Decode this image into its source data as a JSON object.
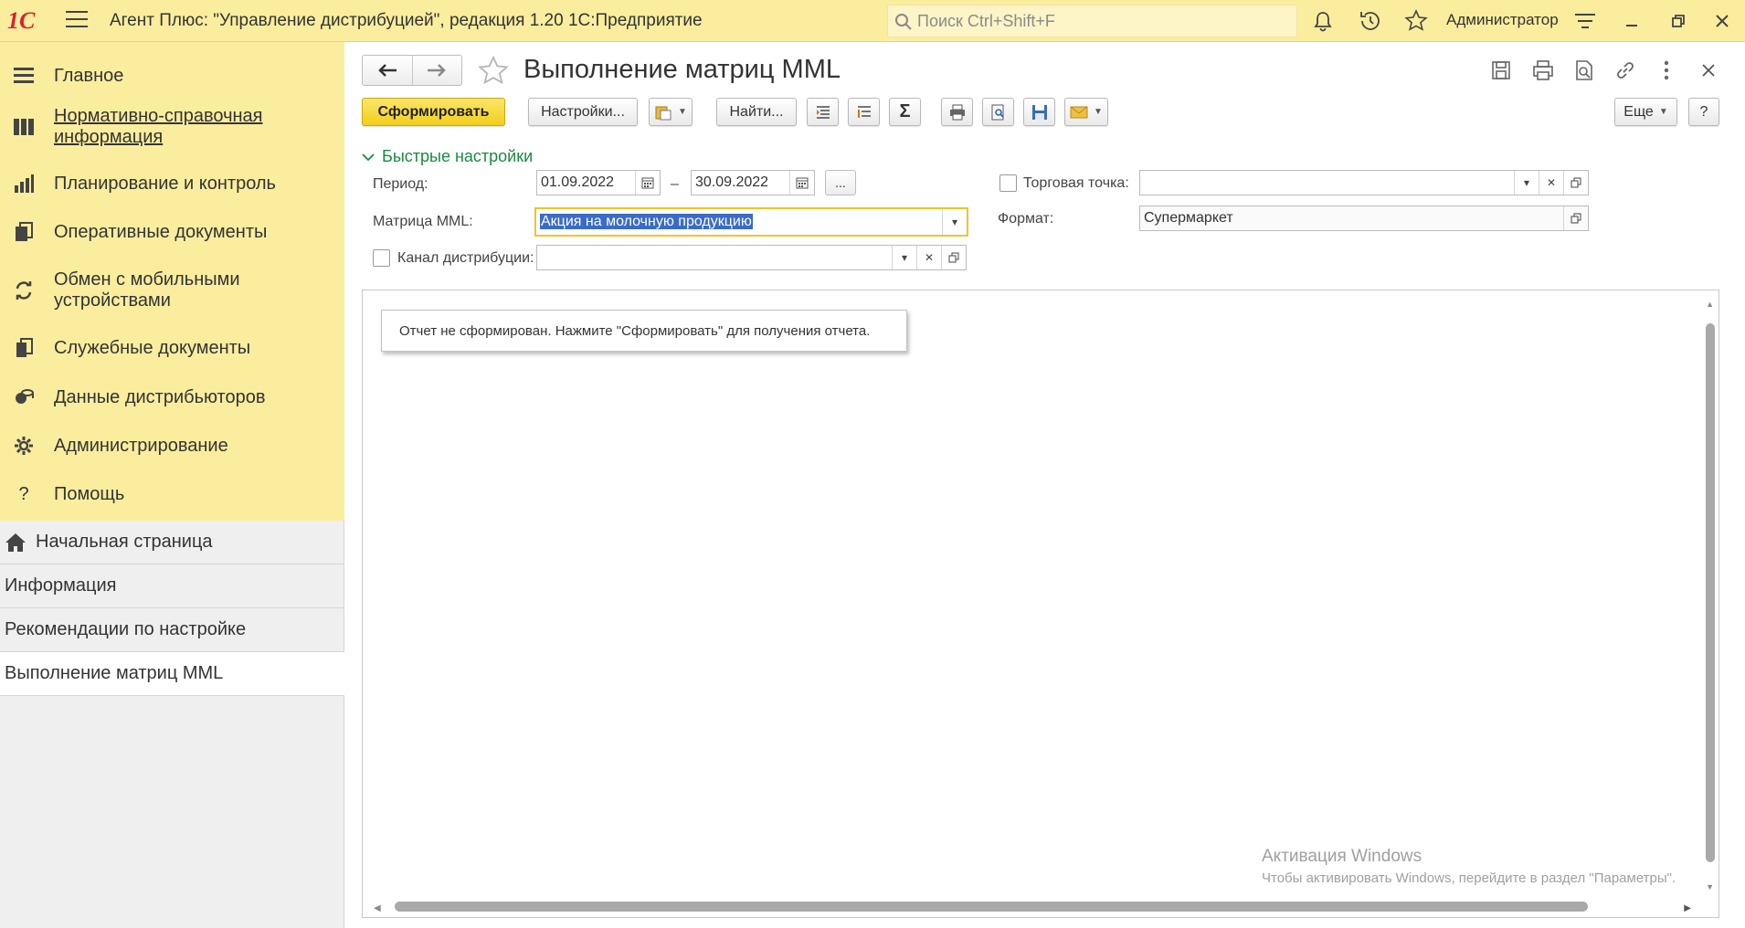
{
  "topbar": {
    "logo_text": "1С",
    "app_title": "Агент Плюс: \"Управление дистрибуцией\", редакция 1.20 1С:Предприятие",
    "search_placeholder": "Поиск Ctrl+Shift+F",
    "user": "Администратор",
    "icons": [
      "bell-icon",
      "history-icon",
      "star-icon",
      "settings-menu-icon",
      "minimize-icon",
      "restore-icon",
      "close-icon"
    ]
  },
  "sidebar": {
    "sections": [
      {
        "label": "Главное",
        "icon": "menu-list-icon"
      },
      {
        "label": "Нормативно-справочная информация",
        "icon": "catalog-icon"
      },
      {
        "label": "Планирование и контроль",
        "icon": "chart-icon"
      },
      {
        "label": "Оперативные документы",
        "icon": "documents-icon"
      },
      {
        "label": "Обмен с мобильными устройствами",
        "icon": "sync-icon"
      },
      {
        "label": "Служебные документы",
        "icon": "service-docs-icon"
      },
      {
        "label": "Данные дистрибьюторов",
        "icon": "distributors-icon"
      },
      {
        "label": "Администрирование",
        "icon": "gear-icon"
      },
      {
        "label": "Помощь",
        "icon": "help-icon"
      }
    ],
    "open_windows": [
      {
        "label": "Начальная страница",
        "icon": "home-icon"
      },
      {
        "label": "Информация"
      },
      {
        "label": "Рекомендации по настройке"
      },
      {
        "label": "Выполнение матриц MML"
      }
    ]
  },
  "form": {
    "title": "Выполнение матриц MML",
    "toolbar": {
      "generate": "Сформировать",
      "settings": "Настройки...",
      "find": "Найти...",
      "more": "Еще",
      "help": "?"
    },
    "quick_settings_label": "Быстрые настройки",
    "period_label": "Период:",
    "period_from": "01.09.2022",
    "period_dash": "–",
    "period_to": "30.09.2022",
    "period_more": "...",
    "matrix_label": "Матрица MML:",
    "matrix_value": "Акция на молочную продукцию",
    "channel_label": "Канал дистрибуции:",
    "channel_value": "",
    "outlet_label": "Торговая точка:",
    "outlet_value": "",
    "format_label": "Формат:",
    "format_value": "Супермаркет",
    "report_message": "Отчет не сформирован. Нажмите \"Сформировать\" для получения отчета."
  },
  "watermark": {
    "line1": "Активация Windows",
    "line2": "Чтобы активировать Windows, перейдите в раздел \"Параметры\"."
  },
  "colors": {
    "topbar_bg": "#fbed9e",
    "sidebar_sections_bg": "#fbed9e",
    "primary_button": "#f2cf1b",
    "group_header": "#1a8a3f",
    "logo_red": "#d9232e"
  }
}
